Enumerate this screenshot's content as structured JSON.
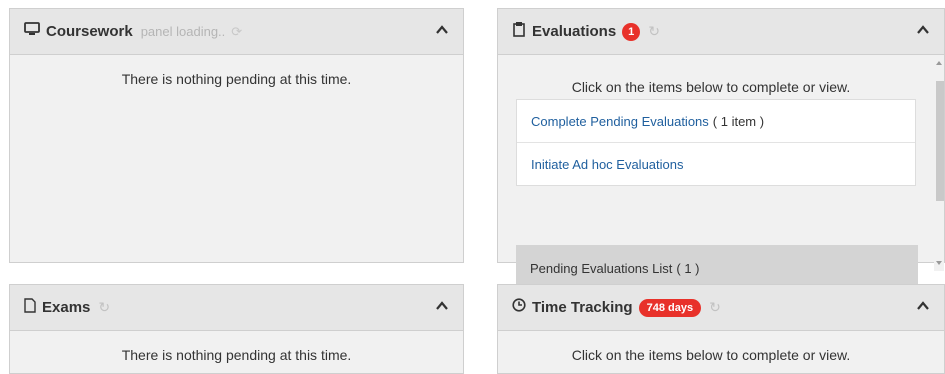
{
  "coursework": {
    "title": "Coursework",
    "loading_text": "panel loading..",
    "message": "There is nothing pending at this time."
  },
  "evaluations": {
    "title": "Evaluations",
    "badge": "1",
    "message": "Click on the items below to complete or view.",
    "links": [
      {
        "label": "Complete Pending Evaluations",
        "count": "( 1 item )"
      },
      {
        "label": "Initiate Ad hoc Evaluations",
        "count": ""
      }
    ],
    "pending_label": "Pending Evaluations List",
    "pending_count": "( 1 )"
  },
  "exams": {
    "title": "Exams",
    "message": "There is nothing pending at this time."
  },
  "time_tracking": {
    "title": "Time Tracking",
    "badge": "748 days",
    "message": "Click on the items below to complete or view."
  },
  "colors": {
    "badge": "#e8312a",
    "link": "#1f5f9e",
    "header_bg": "#e6e6e6",
    "body_bg": "#f1f1f1"
  },
  "icons": {
    "coursework": "monitor-icon",
    "evaluations": "clipboard-icon",
    "exams": "document-icon",
    "time_tracking": "clock-icon",
    "collapse": "chevron-up-icon",
    "refresh": "refresh-icon",
    "spinner": "spinner-icon"
  }
}
